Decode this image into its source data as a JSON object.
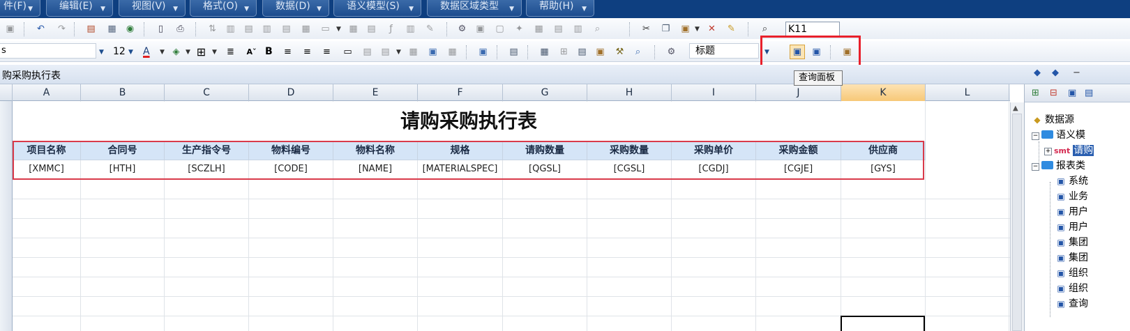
{
  "menubar": {
    "items": [
      {
        "label": "件(F)"
      },
      {
        "label": "编辑(E)"
      },
      {
        "label": "视图(V)"
      },
      {
        "label": "格式(O)"
      },
      {
        "label": "数据(D)"
      },
      {
        "label": "语义模型(S)"
      },
      {
        "label": "数据区域类型"
      },
      {
        "label": "帮助(H)"
      }
    ]
  },
  "toolbar": {
    "cell_reference": "K11",
    "font_name": "s",
    "font_size": "12",
    "bold_label": "B",
    "cell_style": "标题",
    "tooltip": "查询面板"
  },
  "sheet": {
    "title": "购采购执行表"
  },
  "grid": {
    "columns": [
      "A",
      "B",
      "C",
      "D",
      "E",
      "F",
      "G",
      "H",
      "I",
      "J",
      "K",
      "L"
    ],
    "selected_column": "K",
    "report_title": "请购采购执行表",
    "headers": [
      "项目名称",
      "合同号",
      "生产指令号",
      "物料编号",
      "物料名称",
      "规格",
      "请购数量",
      "采购数量",
      "采购单价",
      "采购金额",
      "供应商"
    ],
    "row_values": [
      "[XMMC]",
      "[HTH]",
      "[SCZLH]",
      "[CODE]",
      "[NAME]",
      "[MATERIALSPEC]",
      "[QGSL]",
      "[CGSL]",
      "[CGDJ]",
      "[CGJE]",
      "[GYS]"
    ]
  },
  "right_panel": {
    "tree": [
      {
        "label": "数据源"
      },
      {
        "label": "语义模"
      },
      {
        "prefix": "smt",
        "label": "请购"
      },
      {
        "label": "报表类"
      },
      {
        "label": "系统"
      },
      {
        "label": "业务"
      },
      {
        "label": "用户"
      },
      {
        "label": "用户"
      },
      {
        "label": "集团"
      },
      {
        "label": "集团"
      },
      {
        "label": "组织"
      },
      {
        "label": "组织"
      },
      {
        "label": "查询"
      }
    ]
  },
  "colors": {
    "menubar_bg": "#0e3f80",
    "highlight_red": "#e8202b",
    "header_fill": "#d5e5f7",
    "selected_column": "#f7c877",
    "tree_selection": "#2a5fb0"
  }
}
